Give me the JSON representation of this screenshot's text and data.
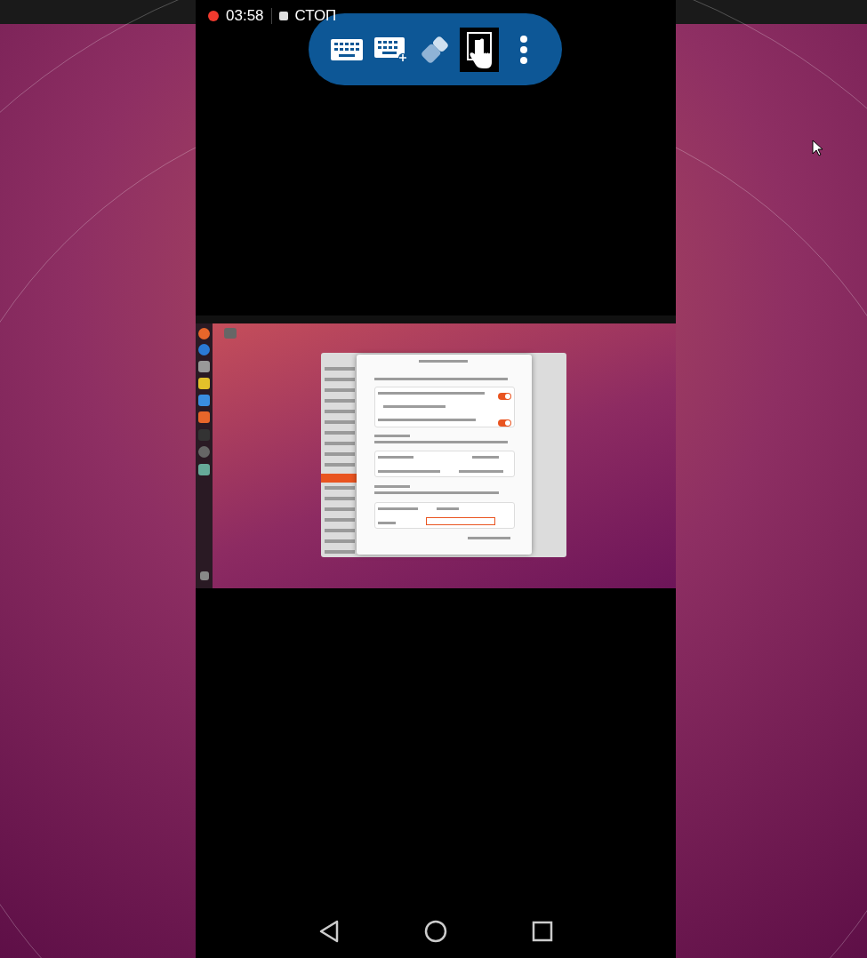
{
  "recording": {
    "active": true,
    "time": "03:58",
    "stop_label": "СТОП"
  },
  "toolbar": [
    {
      "kind": "keyboard",
      "selected": false
    },
    {
      "kind": "keyboard_add",
      "selected": false
    },
    {
      "kind": "eraser",
      "selected": false
    },
    {
      "kind": "touch",
      "selected": true
    },
    {
      "kind": "more",
      "selected": false
    }
  ],
  "remote_dialog": {
    "toggles": [
      {
        "on": true
      },
      {
        "on": true
      }
    ]
  },
  "nav_bar": [
    {
      "kind": "back"
    },
    {
      "kind": "home"
    },
    {
      "kind": "recents"
    }
  ]
}
